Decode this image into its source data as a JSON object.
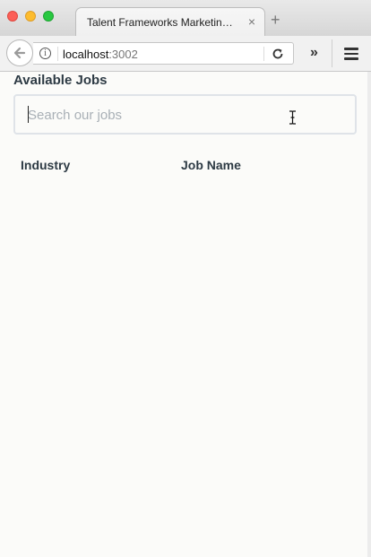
{
  "browser": {
    "tab_title": "Talent Frameworks Marketing ...",
    "tab_close": "×",
    "new_tab": "+",
    "url_host": "localhost",
    "url_port": ":3002",
    "overflow": "»"
  },
  "page": {
    "title": "Available Jobs",
    "search": {
      "placeholder": "Search our jobs",
      "value": ""
    },
    "table": {
      "columns": [
        "Industry",
        "Job Name"
      ],
      "rows": []
    }
  }
}
